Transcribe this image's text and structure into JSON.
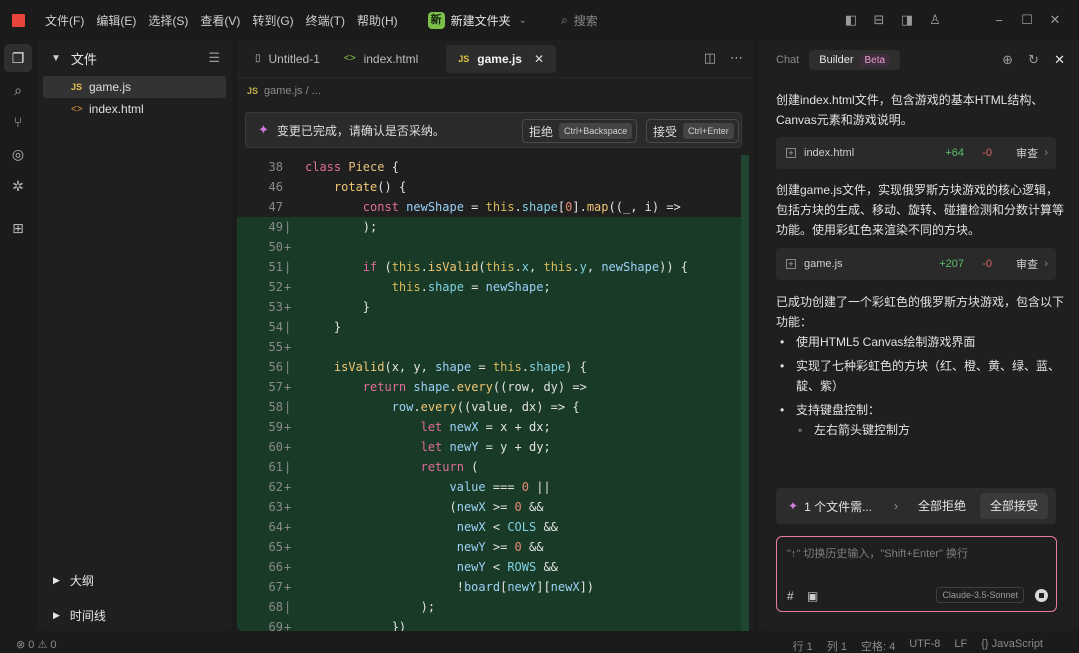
{
  "titlebar": {
    "menu": [
      "文件(F)",
      "编辑(E)",
      "选择(S)",
      "查看(V)",
      "转到(G)",
      "终端(T)",
      "帮助(H)"
    ],
    "project_badge": "新",
    "project_name": "新建文件夹",
    "search_placeholder": "搜索"
  },
  "explorer": {
    "title": "文件",
    "files": [
      {
        "icon": "JS",
        "name": "game.js"
      },
      {
        "icon": "<>",
        "name": "index.html"
      }
    ],
    "outline_label": "大纲",
    "timeline_label": "时间线"
  },
  "editor": {
    "tabs": [
      {
        "name": "Untitled-1"
      },
      {
        "name": "index.html"
      },
      {
        "name": "game.js"
      }
    ],
    "breadcrumb": "game.js / ...",
    "review": {
      "message": "变更已完成，请确认是否采纳。",
      "reject_label": "拒绝",
      "reject_key": "Ctrl+Backspace",
      "accept_label": "接受",
      "accept_key": "Ctrl+Enter"
    },
    "line_numbers": [
      "38",
      "46",
      "47",
      "49",
      "50",
      "51",
      "52",
      "53",
      "54",
      "55",
      "56",
      "57",
      "58",
      "59",
      "60",
      "61",
      "62",
      "63",
      "64",
      "65",
      "66",
      "67",
      "68",
      "69"
    ],
    "line_markers": [
      "",
      "",
      "",
      "|",
      "+",
      "|",
      "+",
      "+",
      "|",
      "+",
      "|",
      "+",
      "|",
      "+",
      "+",
      "|",
      "+",
      "+",
      "+",
      "+",
      "+",
      "+",
      "|",
      "+"
    ]
  },
  "panel": {
    "tab_chat": "Chat",
    "tab_builder": "Builder",
    "beta": "Beta",
    "p1": "创建index.html文件，包含游戏的基本HTML结构、Canvas元素和游戏说明。",
    "card1": {
      "name": "index.html",
      "adds": "+64",
      "dels": "-0",
      "review": "审查"
    },
    "p2": "创建game.js文件，实现俄罗斯方块游戏的核心逻辑，包括方块的生成、移动、旋转、碰撞检测和分数计算等功能。使用彩虹色来渲染不同的方块。",
    "card2": {
      "name": "game.js",
      "adds": "+207",
      "dels": "-0",
      "review": "审查"
    },
    "p3": "已成功创建了一个彩虹色的俄罗斯方块游戏，包含以下功能：",
    "bullets": [
      "使用HTML5 Canvas绘制游戏界面",
      "实现了七种彩虹色的方块（红、橙、黄、绿、蓝、靛、紫）",
      "支持键盘控制："
    ],
    "sub_bullet": "左右箭头键控制方",
    "files_count": "1 个文件需...",
    "reject_all": "全部拒绝",
    "accept_all": "全部接受",
    "input_placeholder": "\"↑\" 切换历史输入，\"Shift+Enter\" 换行",
    "model": "Claude-3.5-Sonnet"
  },
  "statusbar": {
    "problems": "⊗ 0 ⚠ 0",
    "line": "行 1",
    "col": "列 1",
    "spaces": "空格: 4",
    "encoding": "UTF-8",
    "eol": "LF",
    "language": "{} JavaScript"
  },
  "colors": {
    "added_line_bg": "#193a27",
    "accent_pink": "#e87d9c",
    "logo_red": "#e8453c"
  }
}
